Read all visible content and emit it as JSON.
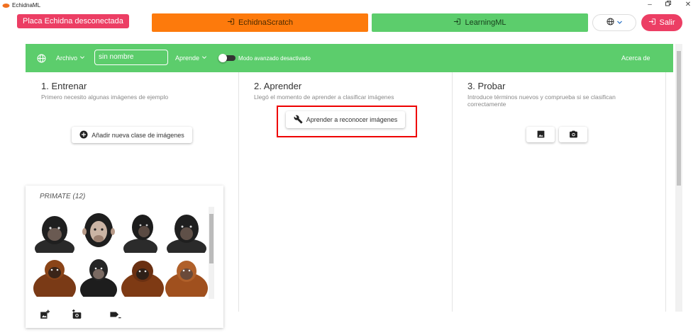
{
  "window": {
    "title": "EchidnaML"
  },
  "topbar": {
    "badge": "Placa Echidna desconectada",
    "scratch_label": "EchidnaScratch",
    "learning_label": "LearningML",
    "exit_label": "Salir"
  },
  "colors": {
    "green": "#5ccd6c",
    "orange": "#fd7a0c",
    "pink": "#ec3e64"
  },
  "menubar": {
    "file_label": "Archivo",
    "project_name": "sin nombre",
    "learn_label": "Aprende",
    "advanced_mode_label": "Modo avanzado desactivado",
    "about_label": "Acerca de"
  },
  "train": {
    "title": "1. Entrenar",
    "subtitle": "Primero necesito algunas imágenes de ejemplo",
    "add_class_label": "Añadir nueva clase de imágenes",
    "class_title": "PRIMATE (12)"
  },
  "learn": {
    "title": "2. Aprender",
    "subtitle": "Llegó el momento de aprender a clasificar imágenes",
    "button_label": "Aprender a reconocer imágenes"
  },
  "test": {
    "title": "3. Probar",
    "subtitle": "Introduce términos nuevos y comprueba si se clasifican correctamente"
  },
  "icons": [
    "globe-icon",
    "chevron-down-icon",
    "login-icon",
    "image-icon",
    "camera-icon",
    "wrench-icon",
    "add-circle-icon",
    "add-photo-icon",
    "add-camera-icon",
    "label-remove-icon"
  ]
}
